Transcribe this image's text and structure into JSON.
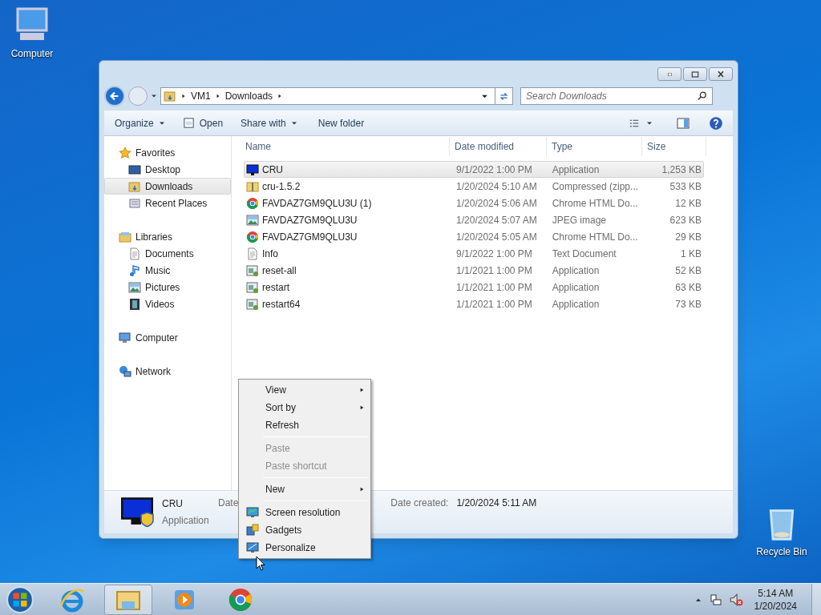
{
  "desktop_icons": [
    {
      "label": "Computer",
      "kind": "computer"
    },
    {
      "label": "Recycle Bin",
      "kind": "bin"
    }
  ],
  "window": {
    "address": [
      "VM1",
      "Downloads"
    ],
    "search": {
      "placeholder": "Search Downloads"
    },
    "toolbar": [
      "Organize",
      "Open",
      "Share with",
      "New folder"
    ],
    "sidebar": [
      {
        "label": "Favorites",
        "kind": "star",
        "selected": false,
        "children": [
          {
            "label": "Desktop",
            "kind": "desktop",
            "selected": false
          },
          {
            "label": "Downloads",
            "kind": "folder",
            "selected": true
          },
          {
            "label": "Recent Places",
            "kind": "recent",
            "selected": false
          }
        ]
      },
      {
        "label": "Libraries",
        "kind": "library",
        "selected": false,
        "children": [
          {
            "label": "Documents",
            "kind": "text",
            "selected": false
          },
          {
            "label": "Music",
            "kind": "music",
            "selected": false
          },
          {
            "label": "Pictures",
            "kind": "image",
            "selected": false
          },
          {
            "label": "Videos",
            "kind": "video",
            "selected": false
          }
        ]
      },
      {
        "label": "Computer",
        "kind": "computer",
        "selected": false
      },
      {
        "label": "Network",
        "kind": "network",
        "selected": false
      }
    ],
    "columns": [
      "Name",
      "Date modified",
      "Type",
      "Size"
    ],
    "rows": [
      {
        "kind": "monitor",
        "selected": true,
        "cells": [
          "CRU",
          "9/1/2022 1:00 PM",
          "Application",
          "1,253 KB"
        ]
      },
      {
        "kind": "zip",
        "selected": false,
        "cells": [
          "cru-1.5.2",
          "1/20/2024 5:10 AM",
          "Compressed (zipp...",
          "533 KB"
        ]
      },
      {
        "kind": "chrome",
        "selected": false,
        "cells": [
          "FAVDAZ7GM9QLU3U (1)",
          "1/20/2024 5:06 AM",
          "Chrome HTML Do...",
          "12 KB"
        ]
      },
      {
        "kind": "image",
        "selected": false,
        "cells": [
          "FAVDAZ7GM9QLU3U",
          "1/20/2024 5:07 AM",
          "JPEG image",
          "623 KB"
        ]
      },
      {
        "kind": "chrome",
        "selected": false,
        "cells": [
          "FAVDAZ7GM9QLU3U",
          "1/20/2024 5:05 AM",
          "Chrome HTML Do...",
          "29 KB"
        ]
      },
      {
        "kind": "text",
        "selected": false,
        "cells": [
          "Info",
          "9/1/2022 1:00 PM",
          "Text Document",
          "1 KB"
        ]
      },
      {
        "kind": "program",
        "selected": false,
        "cells": [
          "reset-all",
          "1/1/2021 1:00 PM",
          "Application",
          "52 KB"
        ]
      },
      {
        "kind": "program",
        "selected": false,
        "cells": [
          "restart",
          "1/1/2021 1:00 PM",
          "Application",
          "63 KB"
        ]
      },
      {
        "kind": "program",
        "selected": false,
        "cells": [
          "restart64",
          "1/1/2021 1:00 PM",
          "Application",
          "73 KB"
        ]
      }
    ],
    "details": {
      "name": "CRU",
      "type": "Application",
      "label_1": "Date",
      "label_2": "Date created:",
      "value_2": "1/20/2024 5:11 AM"
    }
  },
  "context_menu": [
    [
      {
        "label": "View",
        "kind": "plain",
        "disabled": false,
        "submenu": true
      },
      {
        "label": "Sort by",
        "kind": "plain",
        "disabled": false,
        "submenu": true
      },
      {
        "label": "Refresh",
        "kind": "plain",
        "disabled": false,
        "submenu": false
      }
    ],
    [
      {
        "label": "Paste",
        "kind": "plain",
        "disabled": true,
        "submenu": false
      },
      {
        "label": "Paste shortcut",
        "kind": "plain",
        "disabled": true,
        "submenu": false
      }
    ],
    [
      {
        "label": "New",
        "kind": "plain",
        "disabled": false,
        "submenu": true
      }
    ],
    [
      {
        "label": "Screen resolution",
        "kind": "screen",
        "disabled": false,
        "submenu": false
      },
      {
        "label": "Gadgets",
        "kind": "gadgets",
        "disabled": false,
        "submenu": false
      },
      {
        "label": "Personalize",
        "kind": "personalize",
        "disabled": false,
        "submenu": false
      }
    ]
  ],
  "taskbar": {
    "apps": [
      {
        "kind": "ie",
        "selected": false
      },
      {
        "kind": "explorer",
        "selected": true
      },
      {
        "kind": "media",
        "selected": false
      },
      {
        "kind": "chrome",
        "selected": false
      }
    ],
    "time": "5:14 AM",
    "date": "1/20/2024"
  }
}
